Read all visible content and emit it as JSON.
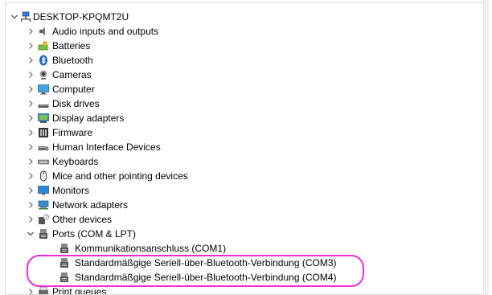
{
  "tree": {
    "root": {
      "label": "DESKTOP-KPQMT2U",
      "icon": "computer-network-icon",
      "expanded": true
    },
    "categories": [
      {
        "label": "Audio inputs and outputs",
        "icon": "speaker-icon",
        "expanded": false
      },
      {
        "label": "Batteries",
        "icon": "battery-icon",
        "expanded": false
      },
      {
        "label": "Bluetooth",
        "icon": "bluetooth-icon",
        "expanded": false
      },
      {
        "label": "Cameras",
        "icon": "camera-icon",
        "expanded": false
      },
      {
        "label": "Computer",
        "icon": "monitor-icon",
        "expanded": false
      },
      {
        "label": "Disk drives",
        "icon": "disk-drive-icon",
        "expanded": false
      },
      {
        "label": "Display adapters",
        "icon": "display-adapter-icon",
        "expanded": false
      },
      {
        "label": "Firmware",
        "icon": "firmware-icon",
        "expanded": false
      },
      {
        "label": "Human Interface Devices",
        "icon": "hid-icon",
        "expanded": false
      },
      {
        "label": "Keyboards",
        "icon": "keyboard-icon",
        "expanded": false
      },
      {
        "label": "Mice and other pointing devices",
        "icon": "mouse-icon",
        "expanded": false
      },
      {
        "label": "Monitors",
        "icon": "monitor-icon",
        "expanded": false
      },
      {
        "label": "Network adapters",
        "icon": "network-adapter-icon",
        "expanded": false
      },
      {
        "label": "Other devices",
        "icon": "unknown-device-icon",
        "expanded": false
      },
      {
        "label": "Ports (COM & LPT)",
        "icon": "port-icon",
        "expanded": true,
        "children": [
          {
            "label": "Kommunikationsanschluss (COM1)",
            "icon": "port-icon"
          },
          {
            "label": "Standardmäßgige Seriell-über-Bluetooth-Verbindung (COM3)",
            "icon": "port-icon"
          },
          {
            "label": "Standardmäßgige Seriell-über-Bluetooth-Verbindung (COM4)",
            "icon": "port-icon"
          }
        ]
      },
      {
        "label": "Print queues",
        "icon": "printer-icon",
        "expanded": false
      }
    ]
  },
  "colors": {
    "highlight": "#f22bd8",
    "selection": "#0078d7"
  }
}
